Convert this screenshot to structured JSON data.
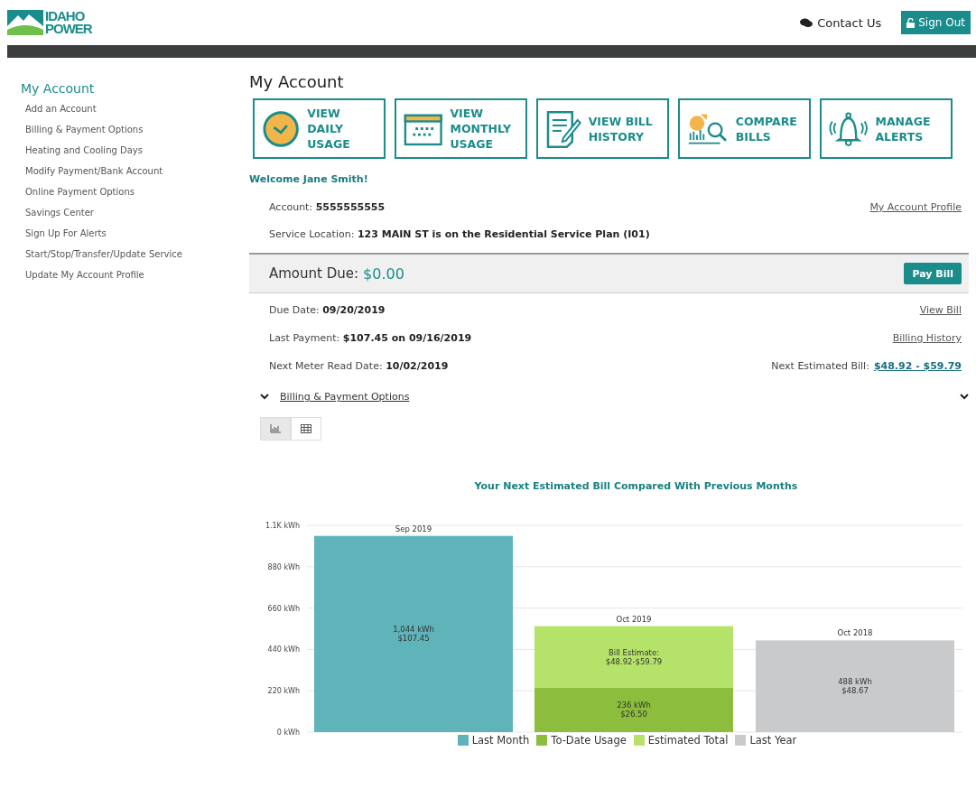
{
  "header": {
    "logo": {
      "line_1": "IDAHO",
      "line_2": "POWER"
    },
    "contact": "Contact Us",
    "sign_out": "Sign Out"
  },
  "sidebar": {
    "title": "My Account",
    "items": [
      "Add an Account",
      "Billing & Payment Options",
      "Heating and Cooling Days",
      "Modify Payment/Bank Account",
      "Online Payment Options",
      "Savings Center",
      "Sign Up For Alerts",
      "Start/Stop/Transfer/Update Service",
      "Update My Account Profile"
    ]
  },
  "page_title": "My Account",
  "tiles": [
    {
      "kind": "clock",
      "label": "VIEW DAILY USAGE"
    },
    {
      "kind": "calendar",
      "label": "VIEW MONTHLY USAGE"
    },
    {
      "kind": "document",
      "label": "VIEW BILL HISTORY"
    },
    {
      "kind": "compare",
      "label": "COMPARE BILLS"
    },
    {
      "kind": "bell",
      "label": "MANAGE ALERTS"
    }
  ],
  "welcome": "Welcome Jane Smith!",
  "account": {
    "number": "Account: **5555555555**",
    "profile_link": "My Account Profile",
    "service": "Service Location: **123 MAIN ST is on the Residential Service Plan (I01)**"
  },
  "amount_due": {
    "label": "Amount Due:",
    "value": "$0.00",
    "button": "Pay Bill"
  },
  "details": [
    {
      "text": "Due Date: **09/20/2019**",
      "right_link": "View Bill"
    },
    {
      "text": "Last Payment: **$107.45 on 09/16/2019**",
      "right_link": "Billing History"
    },
    {
      "text": "Next Meter Read Date: **10/02/2019**",
      "right_label": "Next Estimated Bill:",
      "right_link": "$48.92 - $59.79"
    }
  ],
  "billing_options": "Billing & Payment Options",
  "view_toggle": [
    {
      "kind": "chart",
      "selected": true
    },
    {
      "kind": "table",
      "selected": false
    }
  ],
  "chart": {
    "chart_data": {
      "type": "bar",
      "title": "Your Next Estimated Bill Compared With Previous Months",
      "categories": [
        "Sep 2019",
        "Oct 2019",
        "Oct 2018"
      ],
      "stacked": true,
      "ylim": [
        0,
        1100
      ],
      "legend": true,
      "grid": true,
      "yticks": [
        {
          "value": 0,
          "label": "0 kWh"
        },
        {
          "value": 220,
          "label": "220 kWh"
        },
        {
          "value": 440,
          "label": "440 kWh"
        },
        {
          "value": 660,
          "label": "660 kWh"
        },
        {
          "value": 880,
          "label": "880 kWh"
        },
        {
          "value": 1100,
          "label": "1.1K kWh"
        }
      ],
      "series": [
        {
          "name": "Last Month",
          "color": "#5fb4ba",
          "values": [
            1044,
            null,
            null
          ],
          "value_labels": [
            "1,044 kWh\n$107.45",
            null,
            null
          ]
        },
        {
          "name": "To-Date Usage",
          "color": "#8dbd3c",
          "values": [
            null,
            236,
            null
          ],
          "value_labels": [
            null,
            "236 kWh\n$26.50",
            null
          ]
        },
        {
          "name": "Estimated Total",
          "color": "#b5e36a",
          "values": [
            null,
            328,
            null
          ],
          "value_labels": [
            null,
            "Bill Estimate:\n$48.92-$59.79",
            null
          ]
        },
        {
          "name": "Last Year",
          "color": "#c9cacb",
          "values": [
            null,
            null,
            488
          ],
          "value_labels": [
            null,
            null,
            "488 kWh\n$48.67"
          ]
        }
      ]
    }
  }
}
